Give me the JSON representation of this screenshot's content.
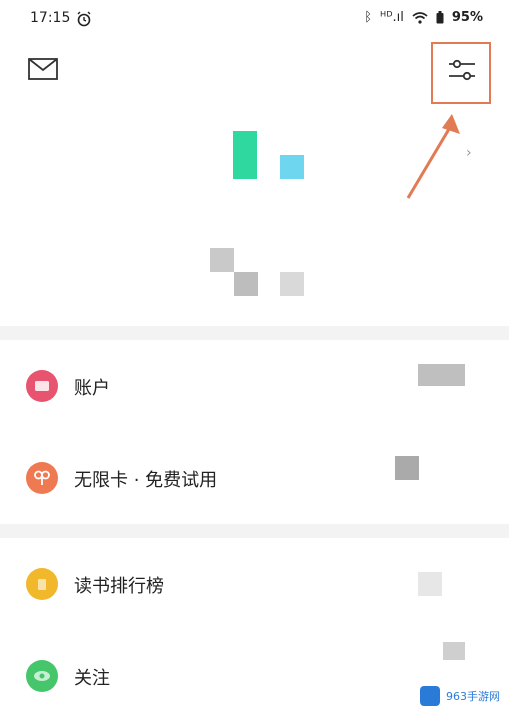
{
  "status_bar": {
    "time": "17:15",
    "signal": "ᴴᴰ.ıl",
    "battery": "95%"
  },
  "header": {
    "mail_icon": "mail-icon",
    "settings_icon": "sliders-settings-icon"
  },
  "menu": {
    "section1": [
      {
        "label": "账户",
        "icon": "account-icon",
        "color": "#e8546f"
      },
      {
        "label": "无限卡 · 免费试用",
        "icon": "unlimited-card-icon",
        "color": "#ef7a52"
      }
    ],
    "section2": [
      {
        "label": "读书排行榜",
        "icon": "ranking-icon",
        "color": "#f2b82c"
      },
      {
        "label": "关注",
        "icon": "follow-icon",
        "color": "#45c66b"
      }
    ]
  },
  "watermark": {
    "text": "963手游网"
  },
  "colors": {
    "highlight": "#e17b53",
    "green_block": "#2fd89e",
    "blue_block": "#6fd6ef"
  }
}
